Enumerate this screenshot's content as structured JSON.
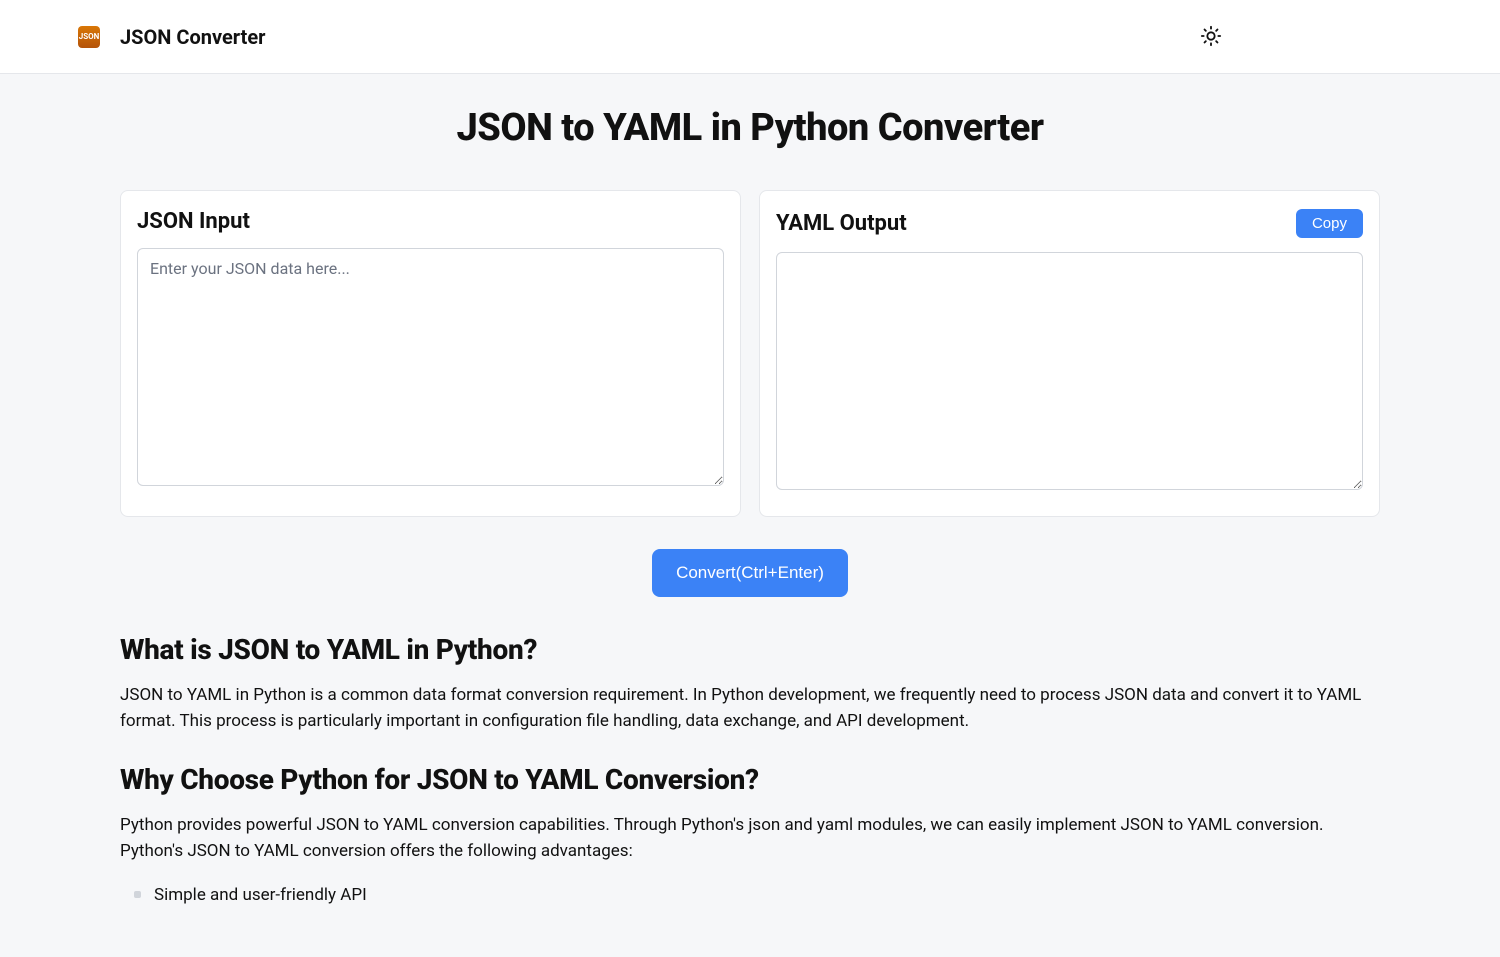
{
  "header": {
    "brand": "JSON Converter",
    "logo_text": "JSON",
    "theme_icon": "sun-icon"
  },
  "page": {
    "title": "JSON to YAML in Python Converter"
  },
  "input_panel": {
    "title": "JSON Input",
    "placeholder": "Enter your JSON data here...",
    "value": ""
  },
  "output_panel": {
    "title": "YAML Output",
    "copy_label": "Copy",
    "value": ""
  },
  "convert": {
    "label": "Convert(Ctrl+Enter)"
  },
  "sections": {
    "what": {
      "heading": "What is JSON to YAML in Python?",
      "body": "JSON to YAML in Python is a common data format conversion requirement. In Python development, we frequently need to process JSON data and convert it to YAML format. This process is particularly important in configuration file handling, data exchange, and API development."
    },
    "why": {
      "heading": "Why Choose Python for JSON to YAML Conversion?",
      "body": "Python provides powerful JSON to YAML conversion capabilities. Through Python's json and yaml modules, we can easily implement JSON to YAML conversion. Python's JSON to YAML conversion offers the following advantages:",
      "bullets": [
        "Simple and user-friendly API"
      ]
    }
  }
}
